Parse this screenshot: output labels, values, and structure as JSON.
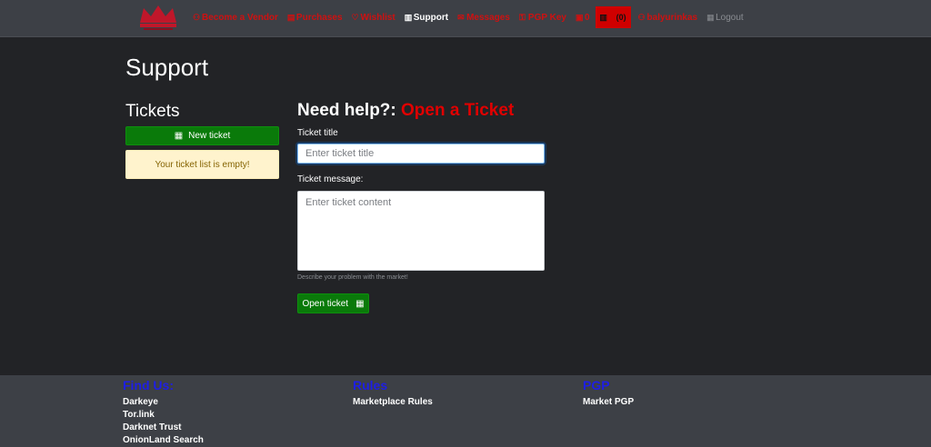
{
  "navbar": {
    "items": [
      {
        "icon": "user-icon",
        "glyph": "⚇",
        "label": "Become a Vendor"
      },
      {
        "icon": "cart-icon",
        "glyph": "▤",
        "label": "Purchases"
      },
      {
        "icon": "heart-icon",
        "glyph": "♡",
        "label": "Wishlist"
      },
      {
        "icon": "support-icon",
        "glyph": "▥",
        "label": "Support"
      },
      {
        "icon": "envelope-icon",
        "glyph": "✉",
        "label": "Messages"
      },
      {
        "icon": "key-icon",
        "glyph": "⚿",
        "label": "PGP Key"
      },
      {
        "icon": "wallet-icon",
        "glyph": "▣",
        "label": "0"
      }
    ],
    "notifications": {
      "glyph": "▥",
      "count": "(0)"
    },
    "user": {
      "glyph": "⚇",
      "label": "balyurinkas"
    },
    "logout": {
      "glyph": "▦",
      "label": "Logout"
    }
  },
  "page": {
    "title": "Support"
  },
  "tickets": {
    "heading": "Tickets",
    "new_button": "New ticket",
    "new_button_glyph": "▦",
    "empty_message": "Your ticket list is empty!"
  },
  "form": {
    "heading_prefix": "Need help?:",
    "heading_accent": "Open a Ticket",
    "title_label": "Ticket title",
    "title_placeholder": "Enter ticket title",
    "message_label": "Ticket message:",
    "message_placeholder": "Enter ticket content",
    "help_text": "Describe your problem with the market!",
    "submit_label": "Open ticket",
    "submit_glyph": "▦"
  },
  "footer": {
    "find_us": {
      "heading": "Find Us:",
      "links": [
        "Darkeye",
        "Tor.link",
        "Darknet Trust",
        "OnionLand Search"
      ]
    },
    "rules": {
      "heading": "Rules",
      "links": [
        "Marketplace Rules"
      ]
    },
    "pgp": {
      "heading": "PGP",
      "links": [
        "Market PGP"
      ]
    }
  },
  "colors": {
    "accent": "#e00000",
    "success": "#0a7a0a",
    "footer_heading": "#1e1ee6",
    "background": "#222326",
    "navbar": "#3d4046"
  }
}
